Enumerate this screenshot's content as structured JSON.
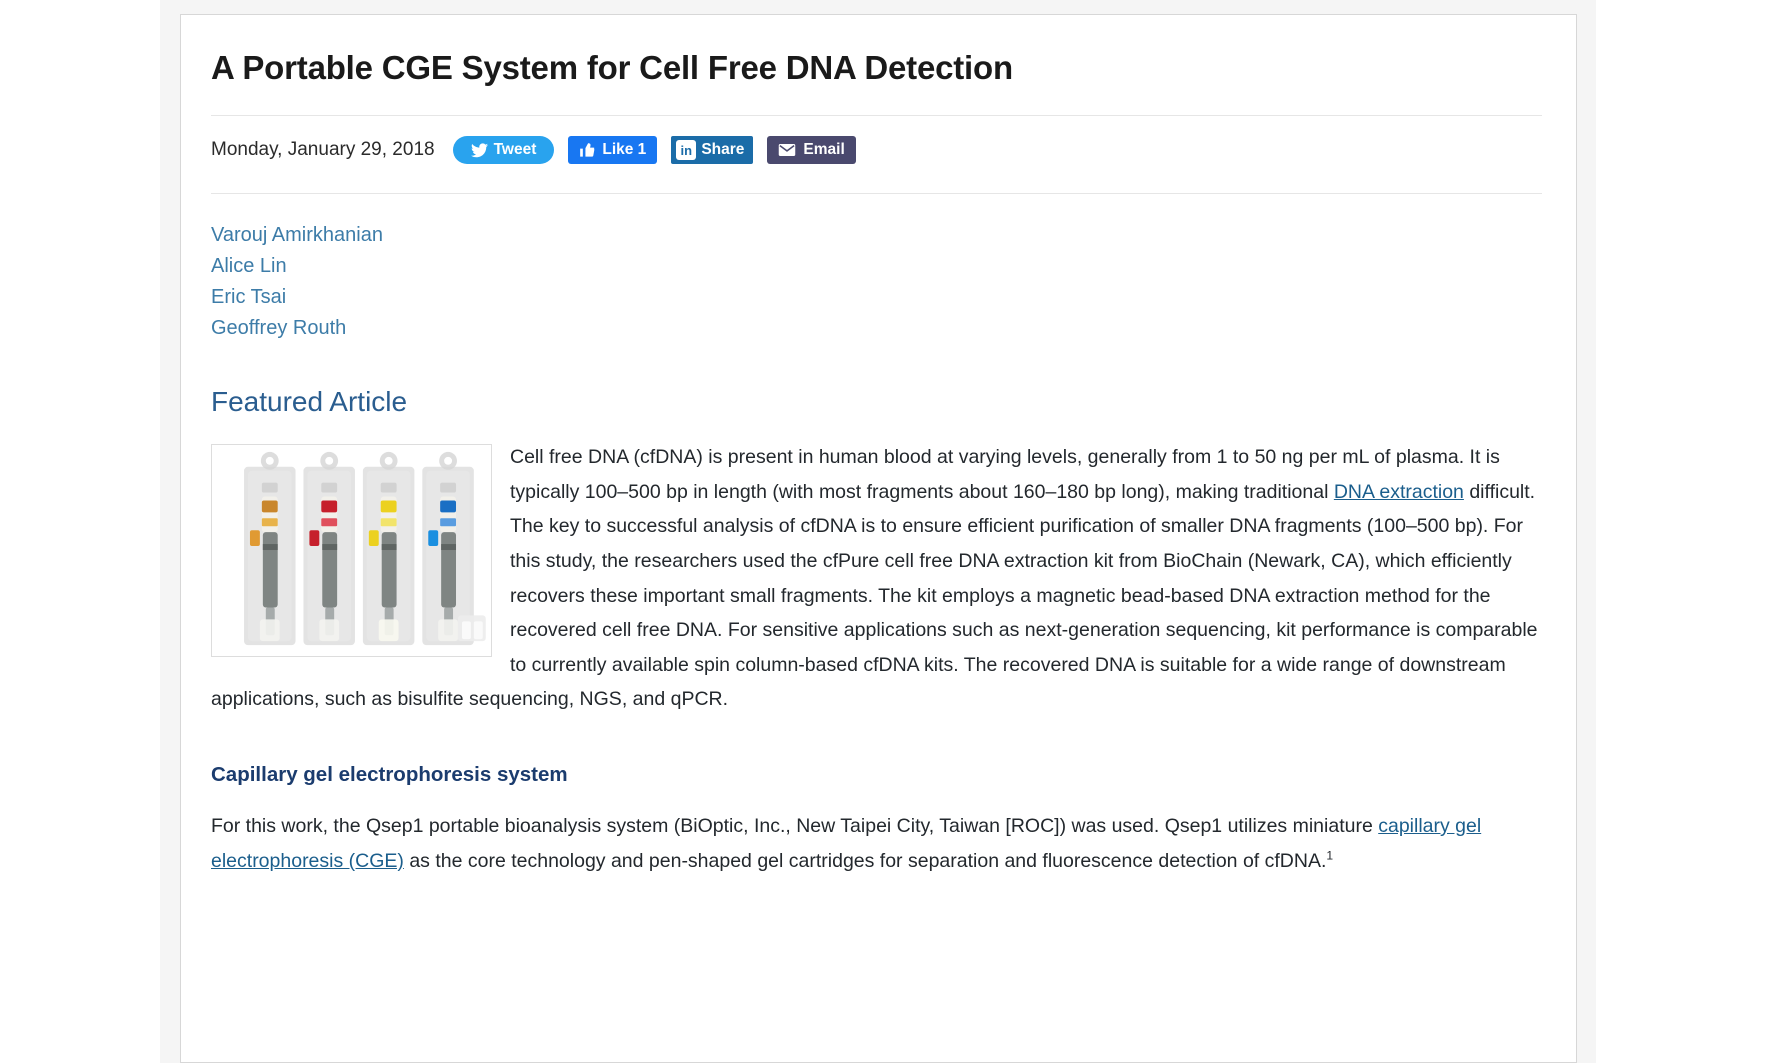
{
  "article": {
    "title": "A Portable CGE System for Cell Free DNA Detection",
    "publish_date": "Monday, January 29, 2018"
  },
  "social": {
    "tweet_label": "Tweet",
    "like_label": "Like 1",
    "share_label": "Share",
    "share_badge": "in",
    "email_label": "Email",
    "colors": {
      "tweet": "#29a3ee",
      "like": "#1877f2",
      "share": "#1b6ca8",
      "email": "#4a496e"
    }
  },
  "authors": [
    {
      "name": "Varouj Amirkhanian"
    },
    {
      "name": "Alice Lin"
    },
    {
      "name": "Eric Tsai"
    },
    {
      "name": "Geoffrey Routh"
    }
  ],
  "featured": {
    "heading": "Featured Article",
    "figure_alt": "Four pen-shaped gel cartridges in blister packaging with orange, red, yellow and blue caps",
    "body_part1": "Cell free DNA (cfDNA) is present in human blood at varying levels, generally from 1 to 50 ng per mL of plasma. It is typically 100–500 bp in length (with most fragments about 160–180 bp long), making traditional ",
    "body_link1": "DNA extraction",
    "body_part2": " difficult. The key to successful analysis of cfDNA is to ensure efficient purification of smaller DNA fragments (100–500 bp). For this study, the researchers used the cfPure cell free DNA extraction kit from BioChain (Newark, CA), which efficiently recovers these important small fragments. The kit employs a magnetic bead-based DNA extraction method for the recovered cell free DNA. For sensitive applications such as next-generation sequencing, kit performance is comparable to currently available spin column-based cfDNA kits. The recovered DNA is suitable for a wide range of downstream applications, such as bisulfite sequencing, NGS, and qPCR."
  },
  "section_cge": {
    "heading": "Capillary gel electrophoresis system",
    "body_part1": "For this work, the Qsep1 portable bioanalysis system (BiOptic, Inc., New Taipei City, Taiwan [ROC]) was used. Qsep1 utilizes miniature ",
    "body_link1": "capillary gel electrophoresis (CGE)",
    "body_part2": " as the core technology and pen-shaped gel cartridges for separation and fluorescence detection of cfDNA.",
    "footnote_marker": "1"
  }
}
